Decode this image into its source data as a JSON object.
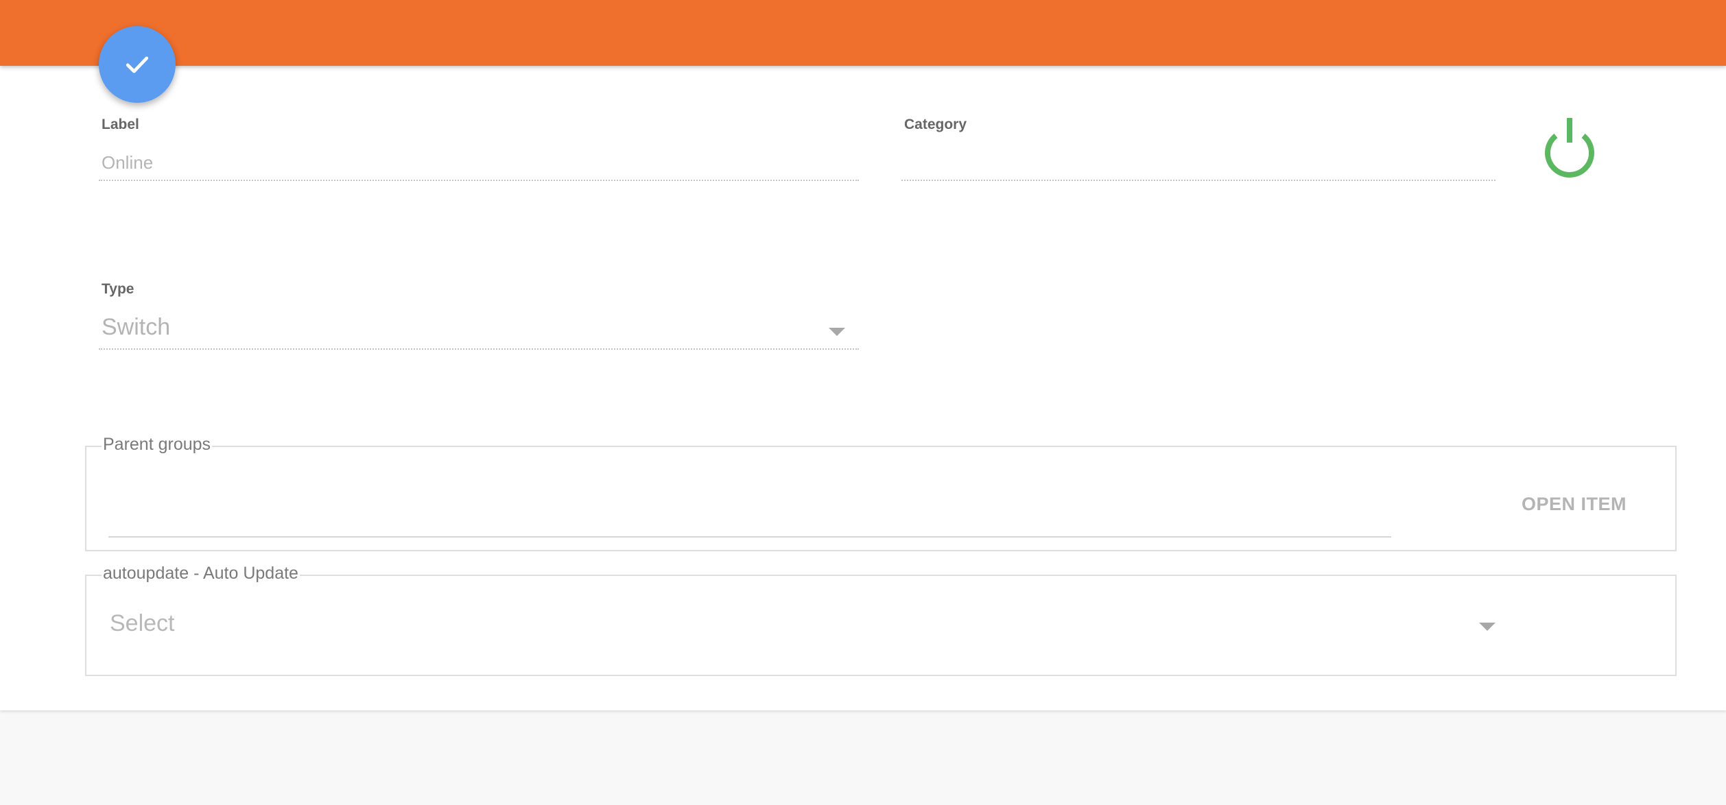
{
  "header": {
    "accent_color": "#ef6f2d"
  },
  "save_fab": {
    "icon": "check-icon",
    "color": "#5b9cf1"
  },
  "label_field": {
    "label": "Label",
    "value": "Online"
  },
  "category_field": {
    "label": "Category",
    "value": ""
  },
  "status": {
    "icon": "power-icon",
    "color": "#5cb860"
  },
  "type_field": {
    "label": "Type",
    "value": "Switch"
  },
  "parent_groups": {
    "legend": "Parent groups",
    "value": "",
    "open_item_label": "OPEN ITEM"
  },
  "autoupdate": {
    "legend": "autoupdate - Auto Update",
    "selected": "Select"
  }
}
